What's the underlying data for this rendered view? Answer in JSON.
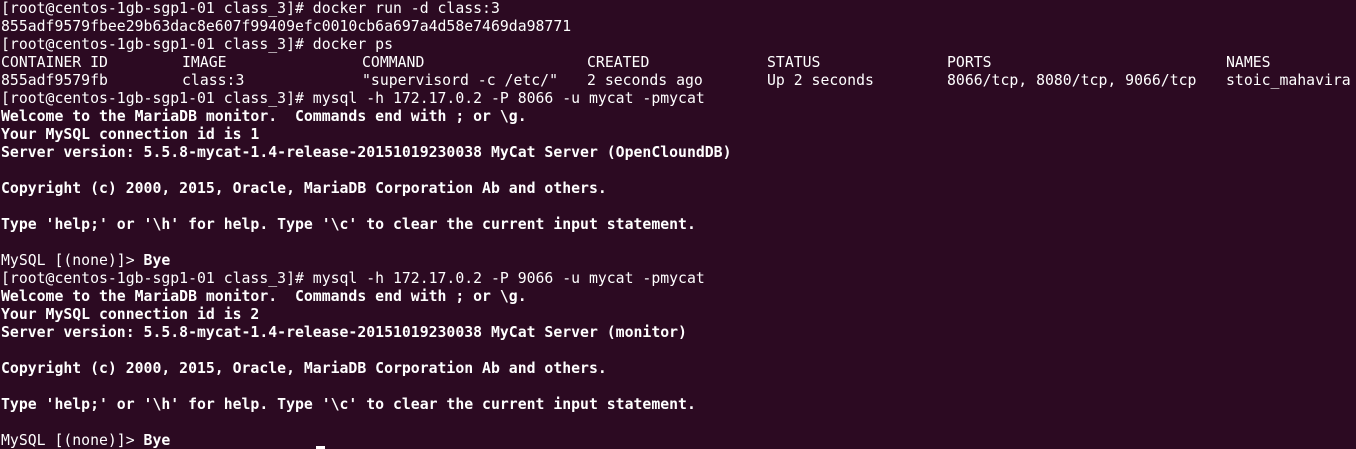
{
  "terminal": {
    "bg_color": "#2c0a22",
    "fg_color": "#ffffff",
    "lines": {
      "l0": "[root@centos-1gb-sgp1-01 class_3]# docker run -d class:3",
      "l1": "855adf9579fbee29b63dac8e607f99409efc0010cb6a697a4d58e7469da98771",
      "l2": "[root@centos-1gb-sgp1-01 class_3]# docker ps",
      "l5": "[root@centos-1gb-sgp1-01 class_3]# mysql -h 172.17.0.2 -P 8066 -u mycat -pmycat",
      "l6": "Welcome to the MariaDB monitor.  Commands end with ; or \\g.",
      "l7": "Your MySQL connection id is 1",
      "l8": "Server version: 5.5.8-mycat-1.4-release-20151019230038 MyCat Server (OpenCloundDB)",
      "l10": "Copyright (c) 2000, 2015, Oracle, MariaDB Corporation Ab and others.",
      "l12": "Type 'help;' or '\\h' for help. Type '\\c' to clear the current input statement.",
      "l14_prompt": "MySQL [(none)]> ",
      "l14_cmd": "Bye",
      "l15": "[root@centos-1gb-sgp1-01 class_3]# mysql -h 172.17.0.2 -P 9066 -u mycat -pmycat",
      "l16": "Welcome to the MariaDB monitor.  Commands end with ; or \\g.",
      "l17": "Your MySQL connection id is 2",
      "l18": "Server version: 5.5.8-mycat-1.4-release-20151019230038 MyCat Server (monitor)",
      "l20": "Copyright (c) 2000, 2015, Oracle, MariaDB Corporation Ab and others.",
      "l22": "Type 'help;' or '\\h' for help. Type '\\c' to clear the current input statement.",
      "l24_prompt": "MySQL [(none)]> ",
      "l24_cmd": "Bye"
    },
    "docker_ps": {
      "headers": {
        "container_id": "CONTAINER ID",
        "image": "IMAGE",
        "command": "COMMAND",
        "created": "CREATED",
        "status": "STATUS",
        "ports": "PORTS",
        "names": "NAMES"
      },
      "row": {
        "container_id": "855adf9579fb",
        "image": "class:3",
        "command": "\"supervisord -c /etc/\"",
        "created": "2 seconds ago",
        "status": "Up 2 seconds",
        "ports": "8066/tcp, 8080/tcp, 9066/tcp",
        "names": "stoic_mahavira"
      }
    }
  }
}
